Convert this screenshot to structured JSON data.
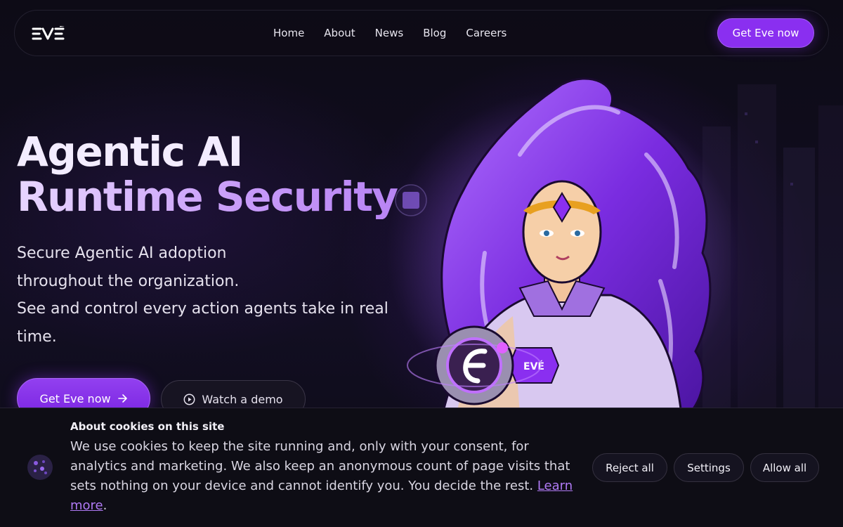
{
  "brand": {
    "logo_text": "EVÉ"
  },
  "nav": {
    "links": [
      "Home",
      "About",
      "News",
      "Blog",
      "Careers"
    ],
    "cta_label": "Get Eve now"
  },
  "hero": {
    "title_line1": "Agentic AI",
    "title_line2": "Runtime Security",
    "subtitle_lines": [
      "Secure Agentic AI adoption",
      "throughout the organization.",
      "See and control every action agents take in real",
      "time."
    ],
    "primary_cta": "Get Eve now",
    "secondary_cta": "Watch a demo"
  },
  "cookie_banner": {
    "title": "About cookies on this site",
    "text": "We use cookies to keep the site running and, only with your consent, for analytics and marketing. We also keep an anonymous count of page visits that sets nothing on your device and cannot identify you. You decide the rest.",
    "link_label": "Learn more",
    "link_suffix": ".",
    "reject_label": "Reject all",
    "settings_label": "Settings",
    "allow_label": "Allow all"
  },
  "colors": {
    "accent": "#8a2ff0",
    "link": "#b07af5",
    "background": "#0b0a12"
  },
  "icons": {
    "arrow": "arrow-right-icon",
    "play": "play-circle-icon",
    "cookie": "cookie-icon"
  }
}
